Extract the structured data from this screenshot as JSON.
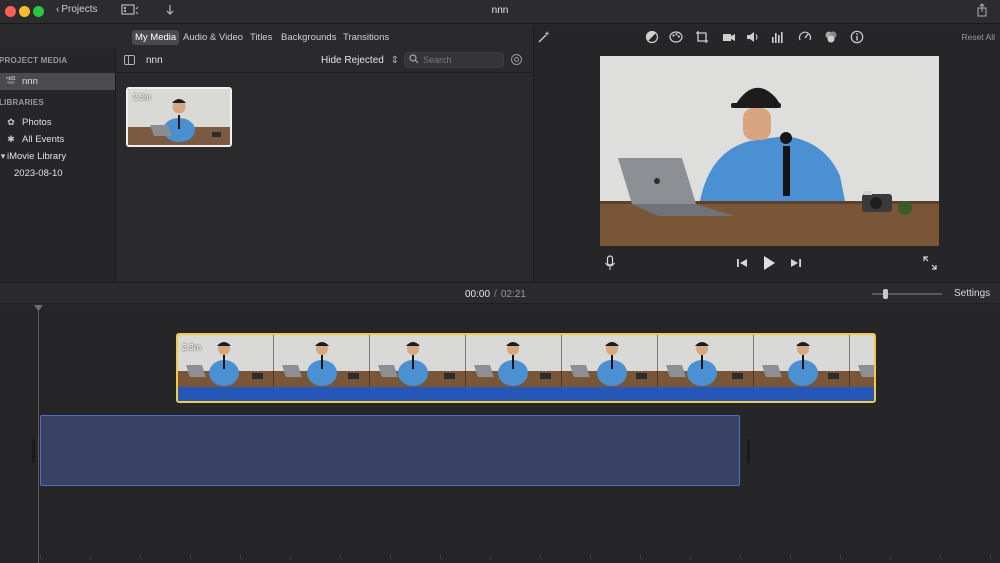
{
  "window": {
    "title": "nnn",
    "projects_label": "Projects"
  },
  "browser_tabs": [
    {
      "label": "My Media",
      "active": true
    },
    {
      "label": "Audio & Video",
      "active": false
    },
    {
      "label": "Titles",
      "active": false
    },
    {
      "label": "Backgrounds",
      "active": false
    },
    {
      "label": "Transitions",
      "active": false
    }
  ],
  "sidebar": {
    "project_media_header": "PROJECT MEDIA",
    "project_item": "nnn",
    "libraries_header": "LIBRARIES",
    "photos": "Photos",
    "all_events": "All Events",
    "library": "iMovie Library",
    "event_date": "2023-08-10"
  },
  "browser": {
    "title": "nnn",
    "filter": "Hide Rejected",
    "search_placeholder": "Search",
    "clip_duration": "2.3m"
  },
  "viewer": {
    "reset_all": "Reset All",
    "tools": [
      "color-balance-icon",
      "color-correction-icon",
      "crop-icon",
      "stabilization-icon",
      "volume-icon",
      "equalizer-icon",
      "speed-icon",
      "filter-icon",
      "info-icon"
    ]
  },
  "timeline": {
    "current_time": "00:00",
    "separator": "/",
    "total_time": "02:21",
    "settings": "Settings",
    "clip_duration": "2.3m",
    "frame_count": 8
  },
  "colors": {
    "accent_clip_border": "#f2c94c",
    "audio_blue": "#2457b7",
    "selected_track": "#3a4264"
  }
}
